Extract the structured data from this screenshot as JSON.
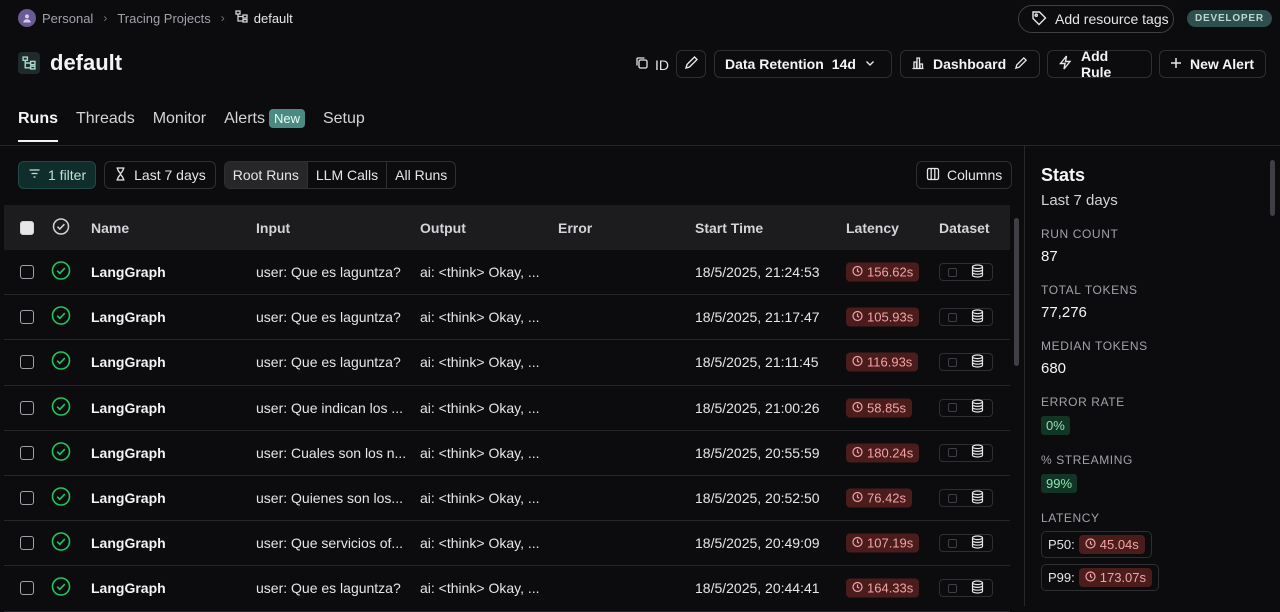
{
  "breadcrumb": {
    "workspace": "Personal",
    "section": "Tracing Projects",
    "project": "default"
  },
  "header": {
    "add_tags_label": "Add resource tags",
    "env_badge": "DEVELOPER",
    "title": "default",
    "id_label": "ID",
    "retention_label": "Data Retention",
    "retention_value": "14d",
    "dashboard_label": "Dashboard",
    "add_rule_label": "Add Rule",
    "new_alert_label": "New Alert"
  },
  "tabs": [
    {
      "label": "Runs",
      "active": true
    },
    {
      "label": "Threads"
    },
    {
      "label": "Monitor"
    },
    {
      "label": "Alerts",
      "badge": "New"
    },
    {
      "label": "Setup"
    }
  ],
  "filters": {
    "filter_label": "1 filter",
    "date_label": "Last 7 days",
    "run_types": [
      "Root Runs",
      "LLM Calls",
      "All Runs"
    ],
    "selected_run_type": "Root Runs",
    "columns_label": "Columns"
  },
  "table": {
    "headers": {
      "name": "Name",
      "input": "Input",
      "output": "Output",
      "error": "Error",
      "start": "Start Time",
      "latency": "Latency",
      "dataset": "Dataset"
    },
    "rows": [
      {
        "name": "LangGraph",
        "input": "user: Que es laguntza?",
        "output": "ai: <think> Okay, ...",
        "error": "",
        "start": "18/5/2025, 21:24:53",
        "latency": "156.62s"
      },
      {
        "name": "LangGraph",
        "input": "user: Que es laguntza?",
        "output": "ai: <think> Okay, ...",
        "error": "",
        "start": "18/5/2025, 21:17:47",
        "latency": "105.93s"
      },
      {
        "name": "LangGraph",
        "input": "user: Que es laguntza?",
        "output": "ai: <think> Okay, ...",
        "error": "",
        "start": "18/5/2025, 21:11:45",
        "latency": "116.93s"
      },
      {
        "name": "LangGraph",
        "input": "user: Que indican los ...",
        "output": "ai: <think> Okay, ...",
        "error": "",
        "start": "18/5/2025, 21:00:26",
        "latency": "58.85s"
      },
      {
        "name": "LangGraph",
        "input": "user: Cuales son los n...",
        "output": "ai: <think> Okay, ...",
        "error": "",
        "start": "18/5/2025, 20:55:59",
        "latency": "180.24s"
      },
      {
        "name": "LangGraph",
        "input": "user: Quienes son los...",
        "output": "ai: <think> Okay, ...",
        "error": "",
        "start": "18/5/2025, 20:52:50",
        "latency": "76.42s"
      },
      {
        "name": "LangGraph",
        "input": "user: Que servicios of...",
        "output": "ai: <think> Okay, ...",
        "error": "",
        "start": "18/5/2025, 20:49:09",
        "latency": "107.19s"
      },
      {
        "name": "LangGraph",
        "input": "user: Que es laguntza?",
        "output": "ai: <think> Okay, ...",
        "error": "",
        "start": "18/5/2025, 20:44:41",
        "latency": "164.33s"
      }
    ]
  },
  "stats": {
    "title": "Stats",
    "period": "Last 7 days",
    "run_count_label": "RUN COUNT",
    "run_count": "87",
    "total_tokens_label": "TOTAL TOKENS",
    "total_tokens": "77,276",
    "median_tokens_label": "MEDIAN TOKENS",
    "median_tokens": "680",
    "error_rate_label": "ERROR RATE",
    "error_rate": "0%",
    "streaming_label": "% STREAMING",
    "streaming": "99%",
    "latency_label": "LATENCY",
    "p50_label": "P50:",
    "p50": "45.04s",
    "p99_label": "P99:",
    "p99": "173.07s"
  },
  "colors": {
    "accent_green": "#22c55e",
    "latency_red": "#f5a3a3",
    "badge_teal": "#4a8a80"
  }
}
